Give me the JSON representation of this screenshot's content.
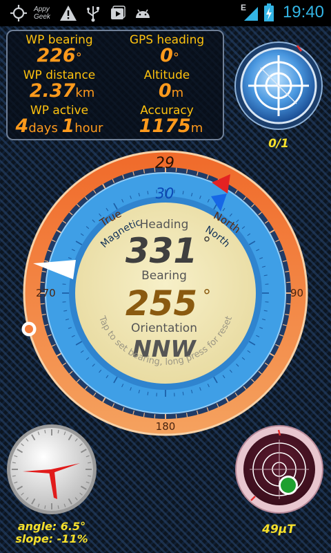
{
  "status_bar": {
    "icons": [
      "gps-icon",
      "appy-geek-icon",
      "warning-icon",
      "usb-icon",
      "media-icon",
      "android-icon",
      "signal-icon",
      "battery-icon"
    ],
    "appy_geek_top": "Appy",
    "appy_geek_bottom": "Geek",
    "network_type": "E",
    "time": "19:40"
  },
  "info_panel": {
    "wp_bearing_label": "WP bearing",
    "wp_bearing_value": "226",
    "wp_bearing_unit": "°",
    "gps_heading_label": "GPS heading",
    "gps_heading_value": "0",
    "gps_heading_unit": "°",
    "wp_distance_label": "WP distance",
    "wp_distance_value": "2.37",
    "wp_distance_unit": "km",
    "altitude_label": "Altitude",
    "altitude_value": "0",
    "altitude_unit": "m",
    "wp_active_label": "WP active",
    "wp_active_days": "4",
    "wp_active_days_unit": "days",
    "wp_active_hours": "1",
    "wp_active_hours_unit": "hour",
    "accuracy_label": "Accuracy",
    "accuracy_value": "1175",
    "accuracy_unit": "m"
  },
  "gps_widget": {
    "count": "0/1"
  },
  "compass": {
    "true_label": "True",
    "true_north_label": "North",
    "true_north_value": "29",
    "magnetic_label": "Magnetic",
    "magnetic_north_label": "North",
    "magnetic_north_value": "30",
    "tick_270": "270",
    "tick_90": "90",
    "tick_180": "180",
    "heading_label": "Heading",
    "heading_value": "331",
    "heading_unit": "°",
    "bearing_label": "Bearing",
    "bearing_value": "255",
    "bearing_unit": "°",
    "orientation_label": "Orientation",
    "orientation_value": "NNW",
    "hint": "Tap to set bearing, long press for reset"
  },
  "inclinometer": {
    "angle": "angle: 6.5°",
    "slope": "slope: -11%"
  },
  "magnetometer": {
    "strength": "49μT"
  },
  "colors": {
    "accent": "#ff9a1c",
    "label": "#ffc20e",
    "clock": "#33b5e5",
    "ring_outer": "#f47d3b",
    "ring_inner": "#3f9fe6",
    "dial_face": "#f3e8b6"
  }
}
